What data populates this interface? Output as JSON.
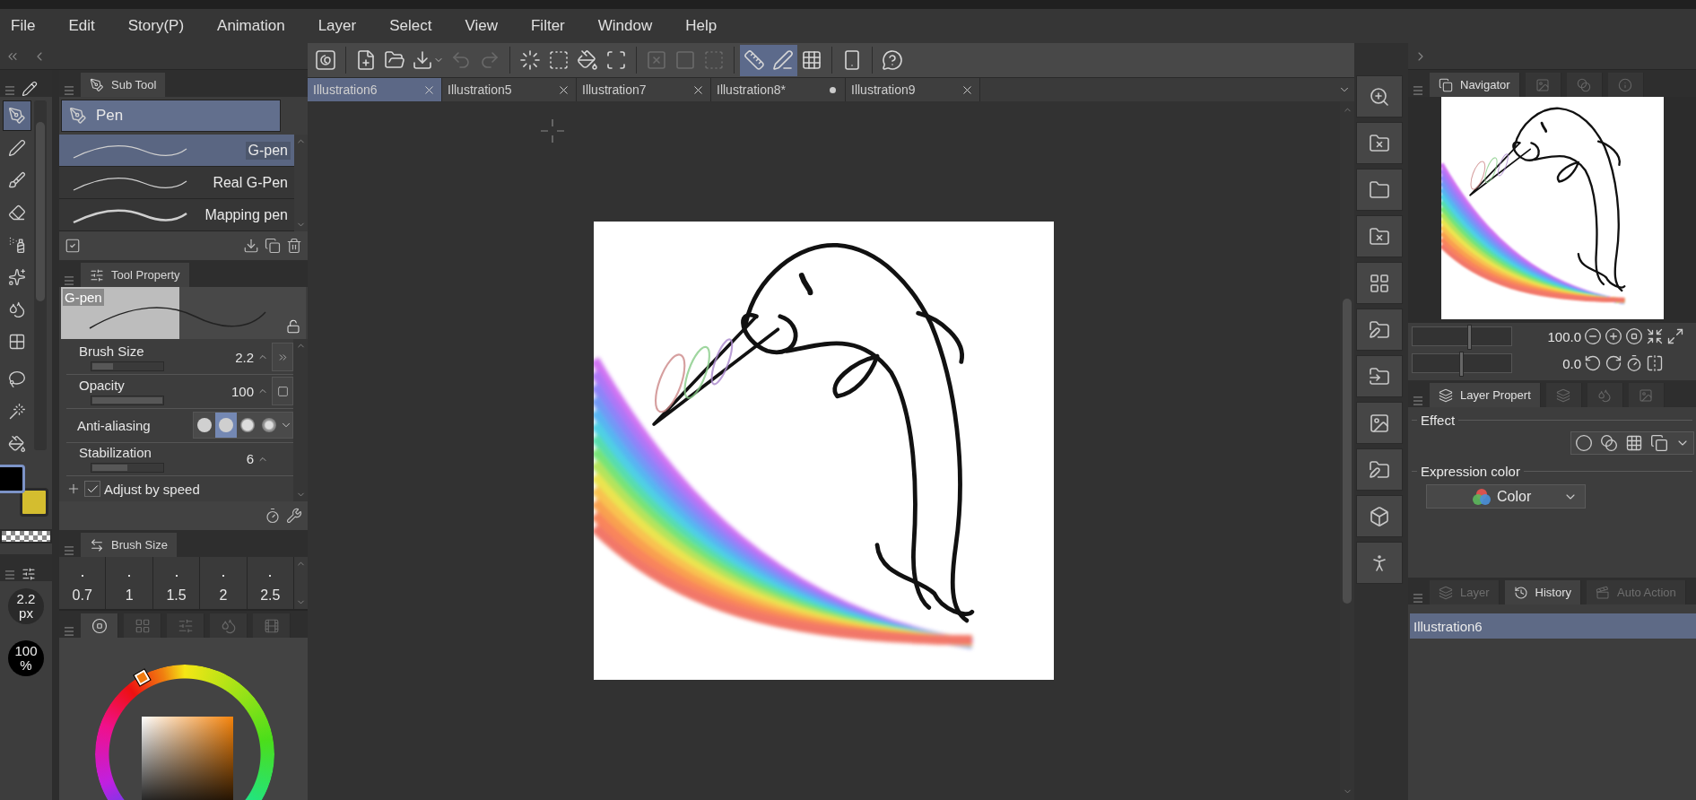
{
  "menu": [
    "File",
    "Edit",
    "Story(P)",
    "Animation",
    "Layer",
    "Select",
    "View",
    "Filter",
    "Window",
    "Help"
  ],
  "tool_palette": {
    "tools": [
      {
        "selected": true
      },
      {
        "selected": false
      },
      {
        "selected": false
      },
      {
        "selected": false
      },
      {
        "selected": false
      },
      {
        "selected": false
      },
      {
        "selected": false
      },
      {
        "selected": false
      },
      {
        "selected": false
      },
      {
        "selected": false
      },
      {
        "selected": false
      }
    ],
    "color_swatches": [
      {
        "color": "#000000",
        "selected": true
      },
      {
        "color": "#d4bd2f",
        "selected": false
      }
    ],
    "brush_size": "2.2",
    "brush_size_unit": "px",
    "opacity": "100",
    "opacity_unit": "%"
  },
  "sub_tool": {
    "title": "Sub Tool",
    "group": {
      "label": "Pen",
      "selected": true
    },
    "brushes": [
      {
        "name": "G-pen",
        "selected": true
      },
      {
        "name": "Real G-Pen",
        "selected": false
      },
      {
        "name": "Mapping pen",
        "selected": false
      }
    ]
  },
  "tool_property": {
    "title": "Tool Property",
    "preview_label": "G-pen",
    "properties": [
      {
        "kind": "slider",
        "label": "Brush Size",
        "value": "2.2",
        "level": 0.3
      },
      {
        "kind": "slider",
        "label": "Opacity",
        "value": "100",
        "level": 1
      },
      {
        "kind": "options",
        "label": "Anti-aliasing",
        "options": [
          {
            "selected": false
          },
          {
            "selected": true
          },
          {
            "selected": false
          },
          {
            "selected": false
          }
        ]
      },
      {
        "kind": "slider",
        "label": "Stabilization",
        "value": "6",
        "level": 0.5
      },
      {
        "kind": "checkbox",
        "label": "Adjust by speed",
        "checked": true
      }
    ]
  },
  "brush_size_panel": {
    "title": "Brush Size",
    "sizes": [
      "0.7",
      "1",
      "1.5",
      "2",
      "2.5"
    ]
  },
  "color_panel": {
    "tabs": [
      {
        "selected": true
      },
      {
        "selected": false
      },
      {
        "selected": false
      },
      {
        "selected": false
      },
      {
        "selected": false
      }
    ]
  },
  "toolbar": [
    {
      "active": false,
      "disabled": false
    },
    {
      "active": false,
      "disabled": false
    },
    {
      "active": false,
      "disabled": false
    },
    {
      "active": false,
      "disabled": false
    },
    {
      "active": false,
      "disabled": true
    },
    {
      "active": false,
      "disabled": true
    },
    {
      "active": false,
      "disabled": false
    },
    {
      "active": false,
      "disabled": false
    },
    {
      "active": false,
      "disabled": false
    },
    {
      "active": false,
      "disabled": false
    },
    {
      "active": false,
      "disabled": true
    },
    {
      "active": false,
      "disabled": true
    },
    {
      "active": false,
      "disabled": true
    },
    {
      "active": true,
      "disabled": false
    },
    {
      "active": true,
      "disabled": false
    },
    {
      "active": false,
      "disabled": false
    },
    {
      "active": false,
      "disabled": false
    },
    {
      "active": false,
      "disabled": false
    }
  ],
  "document_tabs": [
    {
      "label": "Illustration6",
      "selected": true,
      "modified": false
    },
    {
      "label": "Illustration5",
      "selected": false,
      "modified": false
    },
    {
      "label": "Illustration7",
      "selected": false,
      "modified": false
    },
    {
      "label": "Illustration8*",
      "selected": false,
      "modified": true
    },
    {
      "label": "Illustration9",
      "selected": false,
      "modified": false
    }
  ],
  "navigator": {
    "tabs": [
      {
        "label": "Navigator",
        "selected": true
      },
      {
        "selected": false
      },
      {
        "selected": false
      },
      {
        "selected": false
      }
    ],
    "zoom": {
      "value": "100.0",
      "level": 0.58
    },
    "rotation": {
      "value": "0.0",
      "level": 0.5
    }
  },
  "layer_property": {
    "tabs": [
      {
        "label": "Layer Propert",
        "selected": true
      },
      {
        "selected": false
      },
      {
        "selected": false
      },
      {
        "selected": false
      }
    ],
    "effect_label": "Effect",
    "expression_label": "Expression color",
    "expression_value": "Color"
  },
  "bottom_tabs": [
    {
      "label": "Layer",
      "selected": false
    },
    {
      "label": "History",
      "selected": true
    },
    {
      "label": "Auto Action",
      "selected": false
    }
  ],
  "history": [
    {
      "label": "Illustration6",
      "selected": true
    }
  ]
}
